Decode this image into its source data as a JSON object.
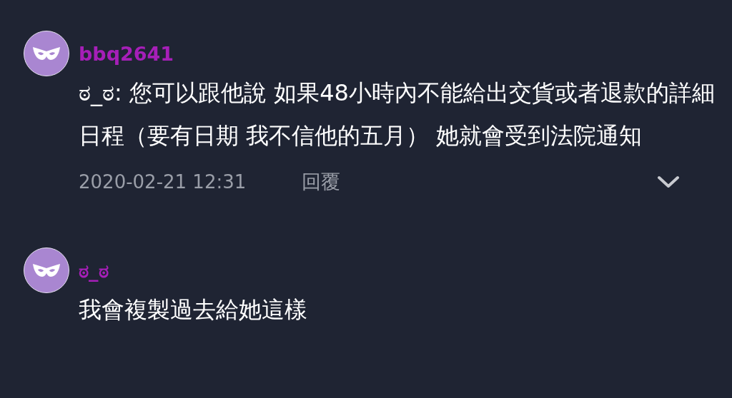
{
  "comments": [
    {
      "author": "bbq2641",
      "text": "ಠ_ಠ: 您可以跟他說 如果48小時內不能給出交貨或者退款的詳細日程（要有日期 我不信他的五月） 她就會受到法院通知",
      "timestamp": "2020-02-21 12:31",
      "reply_label": "回覆",
      "has_menu": true
    },
    {
      "author": "ಠ_ಠ",
      "text": "我會複製過去給她這樣"
    }
  ]
}
